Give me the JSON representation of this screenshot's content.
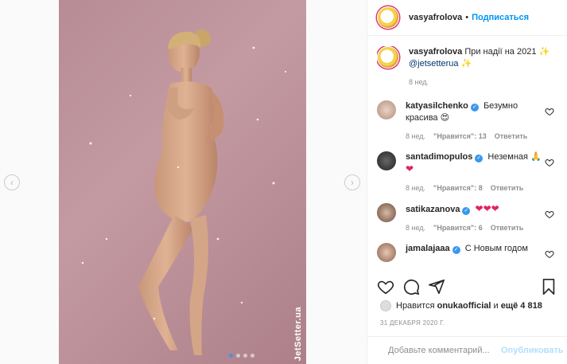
{
  "post": {
    "author": "vasyafrolova",
    "follow_label": "Подписаться",
    "separator": "•",
    "caption_author": "vasyafrolova",
    "caption_text": "При надії на 2021",
    "caption_emoji": "✨",
    "caption_mention": "@jetsetterua",
    "caption_emoji2": "✨",
    "caption_time": "8 нед.",
    "watermark": "JetSetter.ua"
  },
  "comments": [
    {
      "user": "katyasilchenko",
      "verified_icon": "✓",
      "text": "Безумно красива",
      "emoji": "😍",
      "time": "8 нед.",
      "likes": "\"Нравится\": 13",
      "reply": "Ответить"
    },
    {
      "user": "santadimopulos",
      "verified_icon": "✓",
      "text": "Неземная",
      "emoji": "🙏",
      "emoji2": "❤",
      "time": "8 нед.",
      "likes": "\"Нравится\": 8",
      "reply": "Ответить"
    },
    {
      "user": "satikazanova",
      "verified_icon": "✓",
      "text": "",
      "emoji": "❤❤❤",
      "time": "8 нед.",
      "likes": "\"Нравится\": 6",
      "reply": "Ответить"
    },
    {
      "user": "jamalajaaa",
      "verified_icon": "✓",
      "text": "С Новым годом",
      "time": "",
      "likes": "",
      "reply": ""
    }
  ],
  "likes_line": {
    "prefix": "Нравится",
    "user": "onukaofficial",
    "middle": "и",
    "rest": "ещё 4 818"
  },
  "date": "31 ДЕКАБРЯ 2020 Г.",
  "comment_box": {
    "placeholder": "Добавьте комментарий...",
    "publish_label": "Опубликовать"
  },
  "nav": {
    "prev": "‹",
    "next": "›"
  },
  "carousel": {
    "count": 4,
    "active": 1
  },
  "icons": [
    "heart-icon",
    "comment-icon",
    "share-icon",
    "bookmark-icon",
    "emoji-icon"
  ],
  "colors": {
    "accent": "#0095f6",
    "verified": "#3897f0",
    "heart": "#e0245e"
  }
}
